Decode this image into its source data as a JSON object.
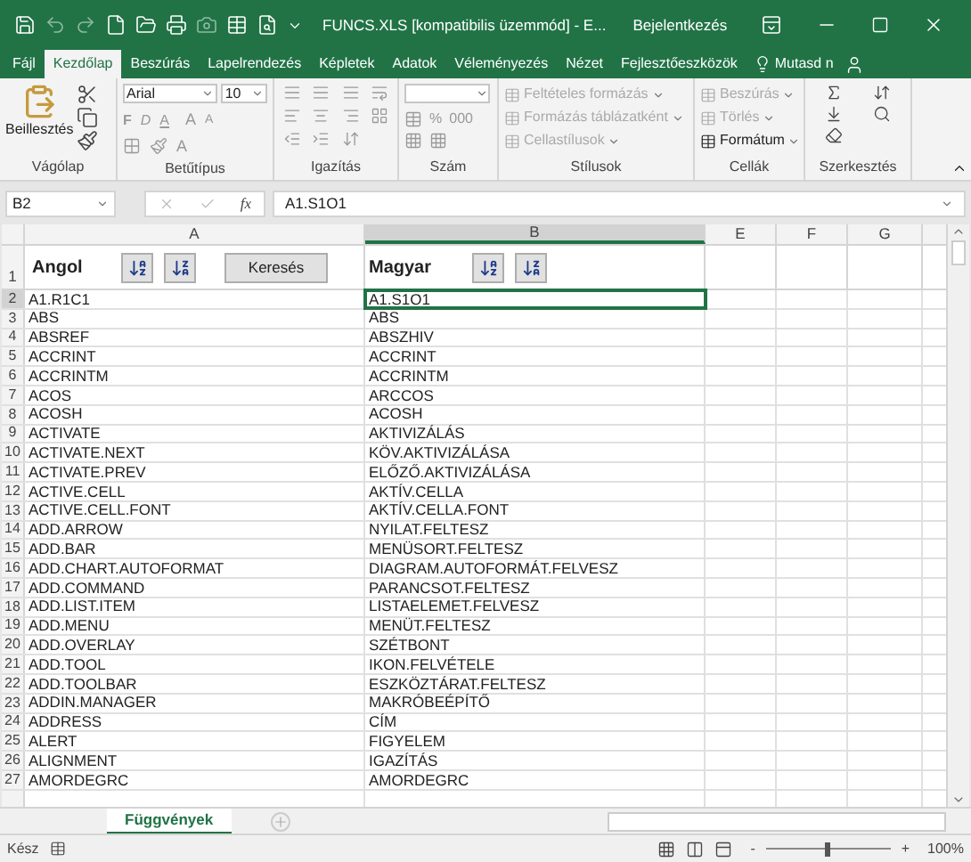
{
  "window": {
    "title": "FUNCS.XLS  [kompatibilis üzemmód] - E...",
    "account": "Bejelentkezés"
  },
  "ribbon_tabs": [
    {
      "label": "Fájl",
      "selected": false
    },
    {
      "label": "Kezdőlap",
      "selected": true
    },
    {
      "label": "Beszúrás",
      "selected": false
    },
    {
      "label": "Lapelrendezés",
      "selected": false
    },
    {
      "label": "Képletek",
      "selected": false
    },
    {
      "label": "Adatok",
      "selected": false
    },
    {
      "label": "Véleményezés",
      "selected": false
    },
    {
      "label": "Nézet",
      "selected": false
    },
    {
      "label": "Fejlesztőeszközök",
      "selected": false
    }
  ],
  "tell_me": "Mutasd n",
  "ribbon": {
    "clipboard": {
      "label": "Vágólap",
      "paste": "Beillesztés"
    },
    "font": {
      "label": "Betűtípus",
      "family": "Arial",
      "size": "10",
      "styles": [
        "F",
        "D",
        "A"
      ],
      "grow": "A",
      "shrink": "A",
      "font_color_label": "A"
    },
    "alignment": {
      "label": "Igazítás"
    },
    "number": {
      "label": "Szám",
      "symbols": [
        "%",
        "000"
      ]
    },
    "styles": {
      "label": "Stílusok",
      "items": [
        {
          "label": "Feltételes formázás",
          "disabled": true
        },
        {
          "label": "Formázás táblázatként",
          "disabled": true
        },
        {
          "label": "Cellastílusok",
          "disabled": true
        }
      ]
    },
    "cells": {
      "label": "Cellák",
      "items": [
        {
          "label": "Beszúrás",
          "disabled": true
        },
        {
          "label": "Törlés",
          "disabled": true
        },
        {
          "label": "Formátum",
          "disabled": false
        }
      ]
    },
    "editing": {
      "label": "Szerkesztés"
    }
  },
  "formula_bar": {
    "name_box": "B2",
    "function_label": "fx",
    "formula": "A1.S1O1"
  },
  "columns": [
    {
      "label": "A",
      "selected": false
    },
    {
      "label": "B",
      "selected": true
    },
    {
      "label": "E",
      "selected": false
    },
    {
      "label": "F",
      "selected": false
    },
    {
      "label": "G",
      "selected": false
    }
  ],
  "header_row": {
    "number": "1",
    "english": "Angol",
    "search_button": "Keresés",
    "hungarian": "Magyar"
  },
  "rows": [
    {
      "number": "2",
      "english": "A1.R1C1",
      "hungarian": "A1.S1O1",
      "selected": true
    },
    {
      "number": "3",
      "english": "ABS",
      "hungarian": "ABS",
      "selected": false
    },
    {
      "number": "4",
      "english": "ABSREF",
      "hungarian": "ABSZHIV",
      "selected": false
    },
    {
      "number": "5",
      "english": "ACCRINT",
      "hungarian": "ACCRINT",
      "selected": false
    },
    {
      "number": "6",
      "english": "ACCRINTM",
      "hungarian": "ACCRINTM",
      "selected": false
    },
    {
      "number": "7",
      "english": "ACOS",
      "hungarian": "ARCCOS",
      "selected": false
    },
    {
      "number": "8",
      "english": "ACOSH",
      "hungarian": "ACOSH",
      "selected": false
    },
    {
      "number": "9",
      "english": "ACTIVATE",
      "hungarian": "AKTIVIZÁLÁS",
      "selected": false
    },
    {
      "number": "10",
      "english": "ACTIVATE.NEXT",
      "hungarian": "KÖV.AKTIVIZÁLÁSA",
      "selected": false
    },
    {
      "number": "11",
      "english": "ACTIVATE.PREV",
      "hungarian": "ELŐZŐ.AKTIVIZÁLÁSA",
      "selected": false
    },
    {
      "number": "12",
      "english": "ACTIVE.CELL",
      "hungarian": "AKTÍV.CELLA",
      "selected": false
    },
    {
      "number": "13",
      "english": "ACTIVE.CELL.FONT",
      "hungarian": "AKTÍV.CELLA.FONT",
      "selected": false
    },
    {
      "number": "14",
      "english": "ADD.ARROW",
      "hungarian": "NYILAT.FELTESZ",
      "selected": false
    },
    {
      "number": "15",
      "english": "ADD.BAR",
      "hungarian": "MENÜSORT.FELTESZ",
      "selected": false
    },
    {
      "number": "16",
      "english": "ADD.CHART.AUTOFORMAT",
      "hungarian": "DIAGRAM.AUTOFORMÁT.FELVESZ",
      "selected": false
    },
    {
      "number": "17",
      "english": "ADD.COMMAND",
      "hungarian": "PARANCSOT.FELTESZ",
      "selected": false
    },
    {
      "number": "18",
      "english": "ADD.LIST.ITEM",
      "hungarian": "LISTAELEMET.FELVESZ",
      "selected": false
    },
    {
      "number": "19",
      "english": "ADD.MENU",
      "hungarian": "MENÜT.FELTESZ",
      "selected": false
    },
    {
      "number": "20",
      "english": "ADD.OVERLAY",
      "hungarian": "SZÉTBONT",
      "selected": false
    },
    {
      "number": "21",
      "english": "ADD.TOOL",
      "hungarian": "IKON.FELVÉTELE",
      "selected": false
    },
    {
      "number": "22",
      "english": "ADD.TOOLBAR",
      "hungarian": "ESZKÖZTÁRAT.FELTESZ",
      "selected": false
    },
    {
      "number": "23",
      "english": "ADDIN.MANAGER",
      "hungarian": "MAKRÓBEÉPÍTŐ",
      "selected": false
    },
    {
      "number": "24",
      "english": "ADDRESS",
      "hungarian": "CÍM",
      "selected": false
    },
    {
      "number": "25",
      "english": "ALERT",
      "hungarian": "FIGYELEM",
      "selected": false
    },
    {
      "number": "26",
      "english": "ALIGNMENT",
      "hungarian": "IGAZÍTÁS",
      "selected": false
    },
    {
      "number": "27",
      "english": "AMORDEGRC",
      "hungarian": "AMORDEGRC",
      "selected": false
    }
  ],
  "sheet_tabs": [
    {
      "label": "Függvények",
      "selected": true
    }
  ],
  "status_bar": {
    "status": "Kész",
    "zoom_out": "-",
    "zoom_in": "+",
    "zoom": "100%",
    "zoom_slider": {
      "level": 0.5
    }
  }
}
